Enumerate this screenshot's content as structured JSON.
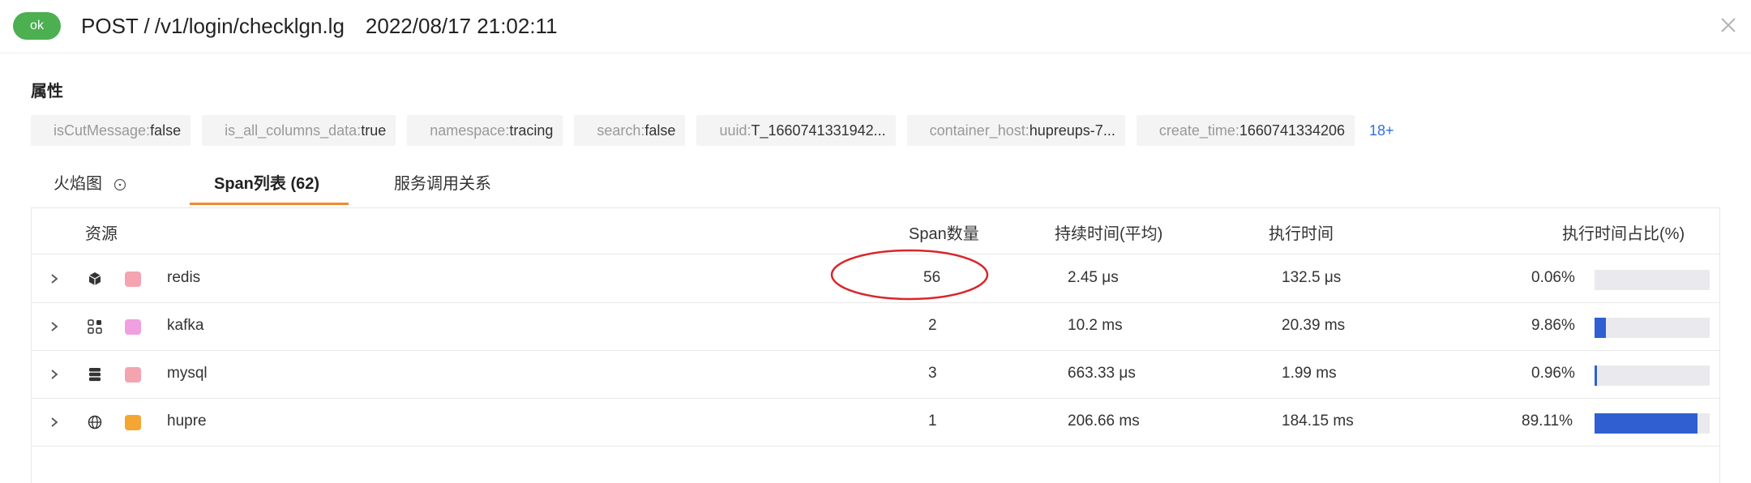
{
  "header": {
    "status": "ok",
    "method": "POST /",
    "path": "/v1/login/checklgn.lg",
    "timestamp": "2022/08/17 21:02:11",
    "close_icon": "close-icon"
  },
  "attributes": {
    "title": "属性",
    "tags": [
      {
        "key": "isCutMessage",
        "value": "false"
      },
      {
        "key": "is_all_columns_data",
        "value": "true"
      },
      {
        "key": "namespace",
        "value": "tracing"
      },
      {
        "key": "search",
        "value": "false"
      },
      {
        "key": "uuid",
        "value": "T_1660741331942..."
      },
      {
        "key": "container_host",
        "value": "hupreups-7..."
      },
      {
        "key": "create_time",
        "value": "1660741334206"
      }
    ],
    "more": "18+"
  },
  "tabs": [
    {
      "label": "火焰图",
      "active": false
    },
    {
      "label": "Span列表 (62)",
      "active": true
    },
    {
      "label": "服务调用关系",
      "active": false
    }
  ],
  "table": {
    "columns": [
      "资源",
      "Span数量",
      "持续时间(平均)",
      "执行时间",
      "执行时间占比(%)"
    ],
    "rows": [
      {
        "icon": "cube-icon",
        "swatch": "#f4a4b0",
        "name": "redis",
        "count": "56",
        "duration": "2.45 μs",
        "exec": "132.5 μs",
        "percent_label": "0.06%",
        "percent": 0.06
      },
      {
        "icon": "grid-icon",
        "swatch": "#f0a0e0",
        "name": "kafka",
        "count": "2",
        "duration": "10.2 ms",
        "exec": "20.39 ms",
        "percent_label": "9.86%",
        "percent": 9.86
      },
      {
        "icon": "database-icon",
        "swatch": "#f4a4b0",
        "name": "mysql",
        "count": "3",
        "duration": "663.33 μs",
        "exec": "1.99 ms",
        "percent_label": "0.96%",
        "percent": 0.96
      },
      {
        "icon": "globe-icon",
        "swatch": "#f5a531",
        "name": "hupre",
        "count": "1",
        "duration": "206.66 ms",
        "exec": "184.15 ms",
        "percent_label": "89.11%",
        "percent": 89.11
      }
    ]
  },
  "colors": {
    "ok": "#4caf50",
    "tab_accent": "#f08a2a",
    "bar": "#2f5fd0",
    "annotation": "#d9262b"
  }
}
